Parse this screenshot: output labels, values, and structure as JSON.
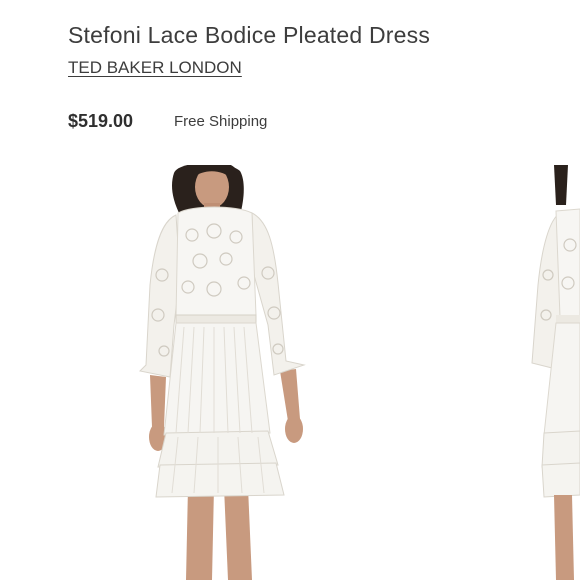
{
  "product": {
    "title": "Stefoni Lace Bodice Pleated Dress",
    "brand": "TED BAKER LONDON",
    "price": "$519.00",
    "shipping": "Free Shipping"
  },
  "gallery": {
    "images": [
      {
        "subject": "model wearing white lace bodice pleated dress",
        "icon": "product-photo"
      },
      {
        "subject": "partial view of next product photo",
        "icon": "product-photo"
      }
    ]
  },
  "colors": {
    "text": "#3d3d3d",
    "dress": "#f7f6f3",
    "skin": "#c89a7f",
    "hair": "#2a211c"
  }
}
